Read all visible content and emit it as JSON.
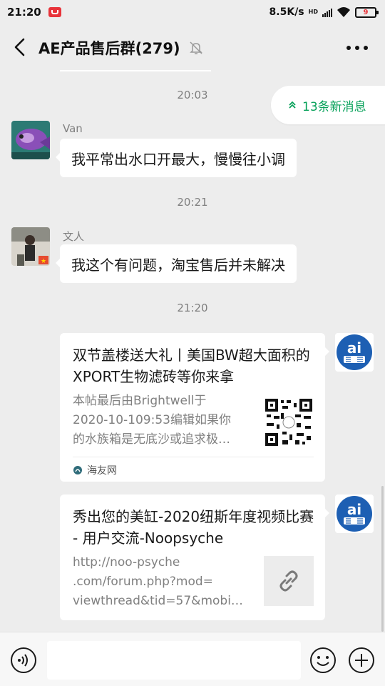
{
  "status_bar": {
    "time": "21:20",
    "net_speed": "8.5K/s",
    "hd_label": "HD",
    "battery": "9"
  },
  "header": {
    "back_icon": "chevron-left-icon",
    "title": "AE产品售后群(279)",
    "mute_icon": "bell-off-icon",
    "more_icon": "more-dots-icon"
  },
  "chat": {
    "new_messages": "13条新消息",
    "timestamps": [
      "20:03",
      "20:21",
      "21:20"
    ],
    "messages": [
      {
        "sender": "Van",
        "text": "我平常出水口开最大，慢慢往小调"
      },
      {
        "sender": "文人",
        "text": "我这个有问题，淘宝售后并未解决"
      }
    ],
    "cards": [
      {
        "title": "双节盖楼送大礼丨美国BW超大面积的XPORT生物滤砖等你来拿",
        "desc_lines": [
          "本帖最后由Brightwell于",
          "2020-10-109:53编辑如果你",
          "的水族箱是无底沙或追求极…"
        ],
        "source": "海友网",
        "thumb_icon": "qr-code-icon"
      },
      {
        "title": "秀出您的美缸-2020纽斯年度视频比赛 - 用户交流-Noopsyche",
        "desc_lines": [
          "http://noo-psyche",
          ".com/forum.php?mod=",
          "viewthread&tid=57&mobi…"
        ],
        "thumb_icon": "link-icon"
      }
    ],
    "self_avatar_text": "ai"
  },
  "input_bar": {
    "voice_icon": "voice-icon",
    "emoji_icon": "emoji-icon",
    "plus_icon": "plus-circle-icon",
    "input_value": ""
  },
  "colors": {
    "background": "#ededed",
    "accent_green": "#07a15a",
    "bubble": "#ffffff",
    "self_avatar_blue": "#1d5fb3"
  }
}
